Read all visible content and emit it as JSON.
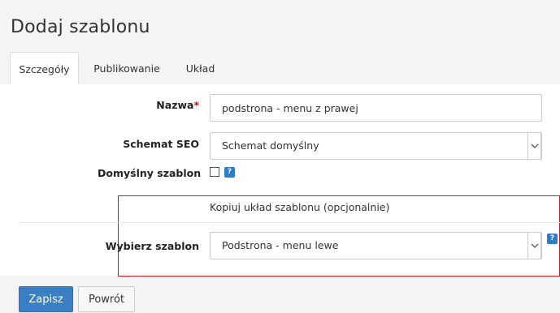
{
  "header": {
    "title": "Dodaj szablonu"
  },
  "tabs": [
    {
      "label": "Szczegóły",
      "active": true
    },
    {
      "label": "Publikowanie",
      "active": false
    },
    {
      "label": "Układ",
      "active": false
    }
  ],
  "form": {
    "name_label": "Nazwa",
    "required_mark": "*",
    "name_value": "podstrona - menu z prawej",
    "seo_label": "Schemat SEO",
    "seo_value": "Schemat domyślny",
    "default_label": "Domyślny szablon",
    "default_checked": false,
    "help_glyph": "?",
    "copy_note": "Kopiuj układ szablonu (opcjonalnie)",
    "template_label": "Wybierz szablon",
    "template_value": "Podstrona - menu lewe"
  },
  "actions": {
    "save_label": "Zapisz",
    "back_label": "Powrót"
  },
  "colors": {
    "accent": "#3a7fc3",
    "help": "#2f7dc7",
    "highlight_border": "#d2151c",
    "required": "#dd0000"
  },
  "icons": {
    "select": "chevron-down-icon",
    "help": "help-icon"
  }
}
